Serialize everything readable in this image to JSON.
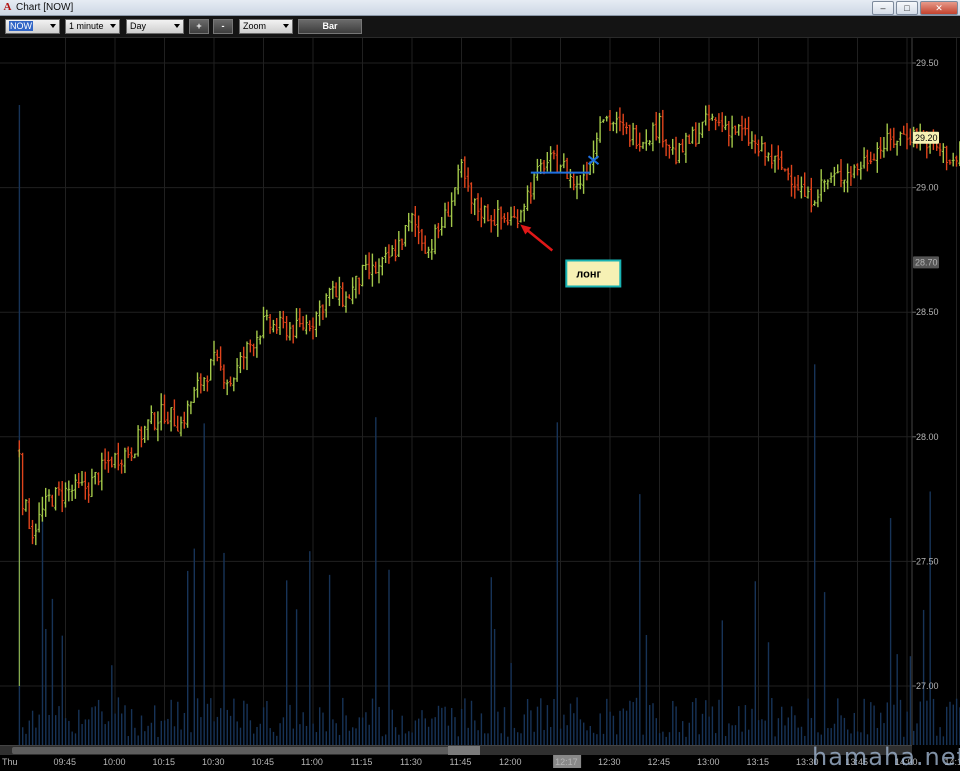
{
  "window": {
    "title": "Chart [NOW]",
    "app_icon_glyph": "A"
  },
  "toolbar": {
    "symbol": "NOW",
    "interval": "1 minute",
    "range": "Day",
    "plus_label": "+",
    "minus_label": "-",
    "zoom_label": "Zoom",
    "style_label": "Bar"
  },
  "annotation": {
    "callout_text": "лонг",
    "arrow_color": "#e01818",
    "entry_line_color": "#1e6fe0",
    "target_mark_color": "#1e6fe0"
  },
  "watermark": "hamaha.net",
  "colors": {
    "up_bar": "#a3c84a",
    "down_bar": "#e0441c",
    "grid": "#202020",
    "volume": "#173357",
    "price_highlight": "#f6f1b4"
  },
  "chart_data": {
    "type": "bar",
    "style": "ohlc-1min",
    "day_label": "Thu",
    "x_time_labels": [
      "09:45",
      "10:00",
      "10:15",
      "10:30",
      "10:45",
      "11:00",
      "11:15",
      "11:30",
      "11:45",
      "12:00",
      "12:17",
      "12:30",
      "12:45",
      "13:00",
      "13:15",
      "13:30",
      "13:45",
      "14:00",
      "14:15"
    ],
    "y_tick_labels": [
      "29.50",
      "29.00",
      "28.50",
      "28.00",
      "27.50",
      "27.00"
    ],
    "y_highlight_labels": [
      "29.20",
      "28.70"
    ],
    "ylim": [
      26.8,
      29.65
    ],
    "grid": true,
    "price_path": [
      {
        "t": "09:31",
        "p": 27.95
      },
      {
        "t": "09:32",
        "p": 27.75
      },
      {
        "t": "09:35",
        "p": 27.62
      },
      {
        "t": "09:40",
        "p": 27.75
      },
      {
        "t": "09:45",
        "p": 27.78
      },
      {
        "t": "09:52",
        "p": 27.8
      },
      {
        "t": "09:58",
        "p": 27.9
      },
      {
        "t": "10:05",
        "p": 27.95
      },
      {
        "t": "10:10",
        "p": 28.05
      },
      {
        "t": "10:15",
        "p": 28.1
      },
      {
        "t": "10:20",
        "p": 28.05
      },
      {
        "t": "10:25",
        "p": 28.2
      },
      {
        "t": "10:30",
        "p": 28.3
      },
      {
        "t": "10:35",
        "p": 28.22
      },
      {
        "t": "10:40",
        "p": 28.35
      },
      {
        "t": "10:45",
        "p": 28.45
      },
      {
        "t": "10:55",
        "p": 28.43
      },
      {
        "t": "11:00",
        "p": 28.47
      },
      {
        "t": "11:05",
        "p": 28.58
      },
      {
        "t": "11:10",
        "p": 28.55
      },
      {
        "t": "11:15",
        "p": 28.65
      },
      {
        "t": "11:20",
        "p": 28.67
      },
      {
        "t": "11:25",
        "p": 28.75
      },
      {
        "t": "11:30",
        "p": 28.87
      },
      {
        "t": "11:35",
        "p": 28.75
      },
      {
        "t": "11:40",
        "p": 28.88
      },
      {
        "t": "11:45",
        "p": 29.07
      },
      {
        "t": "11:48",
        "p": 28.93
      },
      {
        "t": "11:55",
        "p": 28.88
      },
      {
        "t": "12:01",
        "p": 28.87
      },
      {
        "t": "12:06",
        "p": 29.0
      },
      {
        "t": "12:10",
        "p": 29.1
      },
      {
        "t": "12:15",
        "p": 29.1
      },
      {
        "t": "12:20",
        "p": 29.0
      },
      {
        "t": "12:25",
        "p": 29.15
      },
      {
        "t": "12:27",
        "p": 29.3
      },
      {
        "t": "12:35",
        "p": 29.22
      },
      {
        "t": "12:40",
        "p": 29.2
      },
      {
        "t": "12:45",
        "p": 29.25
      },
      {
        "t": "12:50",
        "p": 29.12
      },
      {
        "t": "12:55",
        "p": 29.2
      },
      {
        "t": "13:00",
        "p": 29.27
      },
      {
        "t": "13:05",
        "p": 29.25
      },
      {
        "t": "13:10",
        "p": 29.22
      },
      {
        "t": "13:15",
        "p": 29.15
      },
      {
        "t": "13:20",
        "p": 29.1
      },
      {
        "t": "13:25",
        "p": 29.05
      },
      {
        "t": "13:30",
        "p": 28.95
      },
      {
        "t": "13:35",
        "p": 29.02
      },
      {
        "t": "13:40",
        "p": 29.05
      },
      {
        "t": "13:45",
        "p": 29.08
      },
      {
        "t": "13:50",
        "p": 29.15
      },
      {
        "t": "14:00",
        "p": 29.22
      },
      {
        "t": "14:05",
        "p": 29.2
      },
      {
        "t": "14:10",
        "p": 29.15
      },
      {
        "t": "14:15",
        "p": 29.1
      },
      {
        "t": "14:20",
        "p": 29.2
      },
      {
        "t": "14:25",
        "p": 29.18
      },
      {
        "t": "14:30",
        "p": 29.15
      },
      {
        "t": "14:35",
        "p": 29.17
      },
      {
        "t": "14:40",
        "p": 29.22
      }
    ],
    "entry_level": 29.06,
    "entry_time_range": [
      "12:06",
      "12:24"
    ],
    "arrow_target": {
      "t": "12:01",
      "p": 28.86
    },
    "exit_mark": {
      "t": "12:25",
      "p": 29.11
    }
  }
}
